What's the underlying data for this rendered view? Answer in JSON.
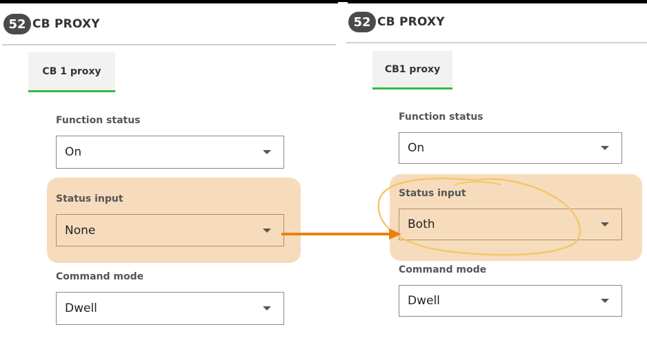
{
  "left_panel": {
    "badge": "52",
    "title": "CB PROXY",
    "tab": "CB 1 proxy",
    "function_status": {
      "label": "Function status",
      "value": "On"
    },
    "status_input": {
      "label": "Status input",
      "value": "None"
    },
    "command_mode": {
      "label": "Command mode",
      "value": "Dwell"
    }
  },
  "right_panel": {
    "badge": "52",
    "title": "CB PROXY",
    "tab": "CB1 proxy",
    "function_status": {
      "label": "Function status",
      "value": "On"
    },
    "status_input": {
      "label": "Status input",
      "value": "Both"
    },
    "command_mode": {
      "label": "Command mode",
      "value": "Dwell"
    }
  },
  "colors": {
    "highlight": "#f6dcbd",
    "arrow": "#e8820e",
    "tab_underline": "#2ebd3f",
    "badge": "#4a4a4a",
    "annotation_circle": "#f5c66a"
  },
  "icons": {
    "dropdown": "chevron-down-icon",
    "annotation_arrow": "arrow-right-icon"
  }
}
